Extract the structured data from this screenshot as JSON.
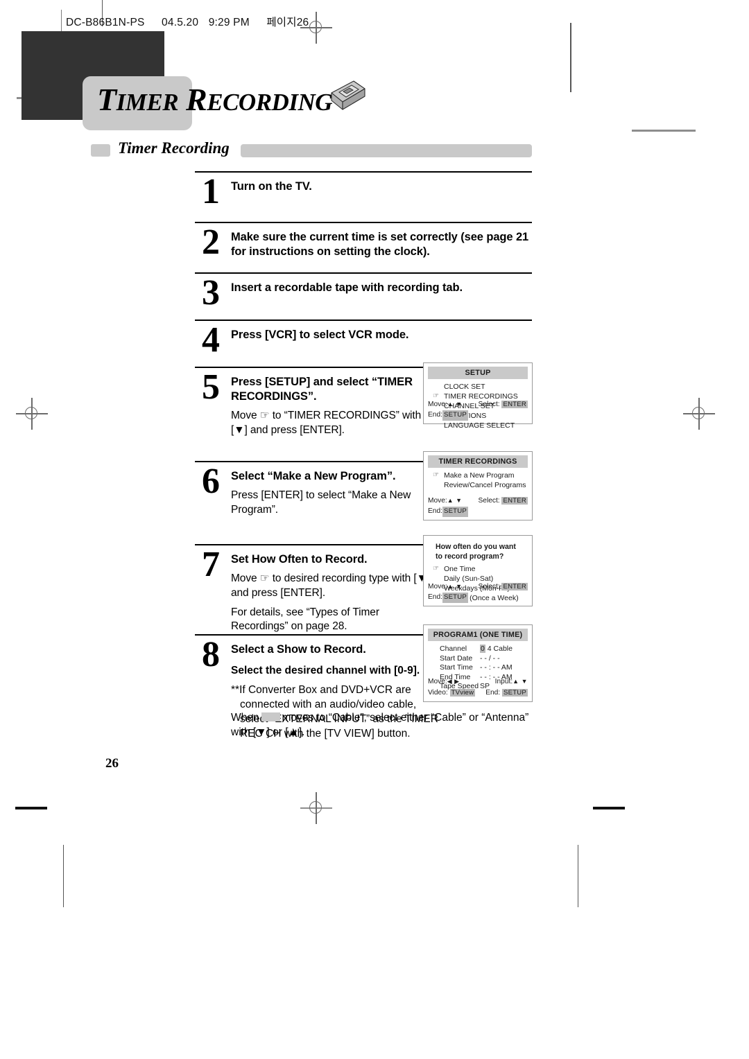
{
  "print_slug": {
    "model": "DC-B86B1N-PS",
    "date": "04.5.20",
    "time": "9:29 PM",
    "page_marker": "페이지26"
  },
  "title": {
    "word1_cap": "T",
    "word1_rest": "IMER",
    "word2_cap": "R",
    "word2_rest": "ECORDING",
    "icon": "vhs-tape-icon"
  },
  "section": {
    "heading": "Timer Recording"
  },
  "steps": [
    {
      "number": "1",
      "head": "Turn on the TV.",
      "text": "",
      "text2": "",
      "sub": "",
      "note": ""
    },
    {
      "number": "2",
      "head": "Make sure the current time is set correctly (see page 21 for instructions on setting the clock).",
      "text": "",
      "text2": "",
      "sub": "",
      "note": ""
    },
    {
      "number": "3",
      "head": "Insert a recordable tape with recording tab.",
      "text": "",
      "text2": "",
      "sub": "",
      "note": ""
    },
    {
      "number": "4",
      "head": "Press [VCR] to select VCR mode.",
      "text": "",
      "text2": "",
      "sub": "",
      "note": ""
    },
    {
      "number": "5",
      "head": "Press [SETUP] and select “TIMER RECORDINGS”.",
      "text": "Move ☞ to “TIMER RECORDINGS” with [▼] and press [ENTER].",
      "text2": "",
      "sub": "",
      "note": ""
    },
    {
      "number": "6",
      "head": "Select “Make a New Program”.",
      "text": "Press [ENTER] to select “Make a New Program”.",
      "text2": "",
      "sub": "",
      "note": ""
    },
    {
      "number": "7",
      "head": "Set How Often to Record.",
      "text": "Move ☞ to desired recording type with [▼] and press [ENTER].",
      "text2": "For details, see “Types of Timer Recordings” on page 28.",
      "sub": "",
      "note": ""
    },
    {
      "number": "8",
      "head": "Select a Show to Record.",
      "sub": "Select the desired channel with [0-9].",
      "note": "**If Converter Box and DVD+VCR are connected with an audio/video cable, select “EXTERNAL INPUT” as the TIMER REC CH with the [TV VIEW] button.",
      "text": "",
      "text2": ""
    }
  ],
  "tail_paragraph": {
    "before": "When",
    "after": "moves to “Cable”, select either “Cable” or “Antenna” with [▼] or [▲]."
  },
  "page_number": "26",
  "osd_screens": [
    {
      "id": "setup",
      "title": "SETUP",
      "items": [
        {
          "cursor": "",
          "label": "CLOCK SET"
        },
        {
          "cursor": "☞",
          "label": "TIMER RECORDINGS"
        },
        {
          "cursor": "",
          "label": "CHANNEL SET"
        },
        {
          "cursor": "",
          "label": "FUNCTIONS"
        },
        {
          "cursor": "",
          "label": "LANGUAGE SELECT"
        }
      ],
      "footer": {
        "move_label": "Move:",
        "move_keys": "▲ ▼",
        "select_label": "Select:",
        "select_key": "ENTER",
        "end_label": "End:",
        "end_key": "SETUP"
      }
    },
    {
      "id": "timer-recordings",
      "title": "TIMER RECORDINGS",
      "items": [
        {
          "cursor": "☞",
          "label": "Make a New Program"
        },
        {
          "cursor": "",
          "label": "Review/Cancel Programs"
        }
      ],
      "footer": {
        "move_label": "Move:",
        "move_keys": "▲ ▼",
        "select_label": "Select:",
        "select_key": "ENTER",
        "end_label": "End:",
        "end_key": "SETUP"
      }
    },
    {
      "id": "how-often",
      "question_line1": "How often do you want",
      "question_line2": "to record program?",
      "items": [
        {
          "cursor": "☞",
          "label": "One Time"
        },
        {
          "cursor": "",
          "label": "Daily (Sun-Sat)"
        },
        {
          "cursor": "",
          "label": "Weekdays (Mon-Fri)"
        },
        {
          "cursor": "",
          "label": "Weekly (Once a Week)"
        }
      ],
      "footer": {
        "move_label": "Move:",
        "move_keys": "▲ ▼",
        "select_label": "Select:",
        "select_key": "ENTER",
        "end_label": "End:",
        "end_key": "SETUP"
      }
    },
    {
      "id": "program1",
      "title": "PROGRAM1  (ONE TIME)",
      "rows": [
        {
          "label": "Channel",
          "value_hl": "0",
          "value": " 4 Cable"
        },
        {
          "label": "Start Date",
          "value_hl": "",
          "value": "- - / - -"
        },
        {
          "label": "Start Time",
          "value_hl": "",
          "value": "- - : - - AM"
        },
        {
          "label": "End Time",
          "value_hl": "",
          "value": "- - : - - AM"
        },
        {
          "label": "Tape Speed",
          "value_hl": "",
          "value": "SP"
        }
      ],
      "footer": {
        "move_label": "Move:",
        "move_keys": "◀ ▶",
        "input_label": "Input:",
        "input_keys": "▲ ▼",
        "video_label": "Video:",
        "video_key": "TVview",
        "end_label": "End:",
        "end_key": "SETUP"
      }
    }
  ],
  "colors": {
    "dark_block": "#333333",
    "gray_plate": "#c9c9c9",
    "osd_border": "#9a9a9a",
    "key_bg": "#b9b9b9"
  }
}
